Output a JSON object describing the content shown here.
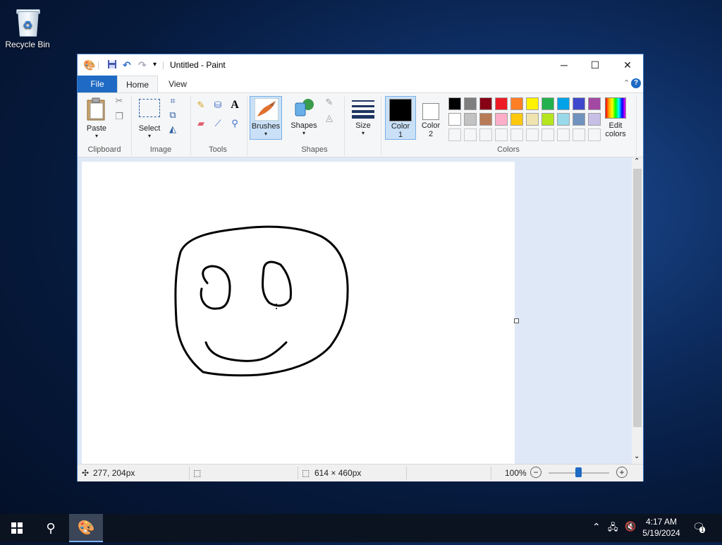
{
  "desktop": {
    "recycle_bin_label": "Recycle Bin"
  },
  "window": {
    "title": "Untitled - Paint",
    "controls": {
      "minimize": "─",
      "maximize": "☐",
      "close": "✕"
    }
  },
  "tabs": [
    {
      "label": "File"
    },
    {
      "label": "Home"
    },
    {
      "label": "View"
    }
  ],
  "ribbon": {
    "clipboard": {
      "label": "Clipboard",
      "paste": "Paste"
    },
    "image": {
      "label": "Image",
      "select": "Select"
    },
    "tools": {
      "label": "Tools"
    },
    "brushes": {
      "label": "Brushes"
    },
    "shapes": {
      "label": "Shapes",
      "shapes_btn": "Shapes"
    },
    "size": {
      "label": "Size"
    },
    "colors": {
      "label": "Colors",
      "color1_line1": "Color",
      "color1_line2": "1",
      "color2_line1": "Color",
      "color2_line2": "2",
      "edit_line1": "Edit",
      "edit_line2": "colors",
      "color1_value": "#000000",
      "color2_value": "#ffffff",
      "palette_row1": [
        "#000000",
        "#7f7f7f",
        "#880015",
        "#ed1c24",
        "#ff7f27",
        "#fff200",
        "#22b14c",
        "#00a2e8",
        "#3f48cc",
        "#a349a4"
      ],
      "palette_row2": [
        "#ffffff",
        "#c3c3c3",
        "#b97a57",
        "#ffaec9",
        "#ffc90e",
        "#efe4b0",
        "#b5e61d",
        "#99d9ea",
        "#7092be",
        "#c8bfe7"
      ]
    }
  },
  "status": {
    "cursor_pos": "277, 204px",
    "image_size": "614 × 460px",
    "zoom": "100%"
  },
  "taskbar": {
    "time": "4:17 AM",
    "date": "5/19/2024",
    "notification_count": "1"
  }
}
